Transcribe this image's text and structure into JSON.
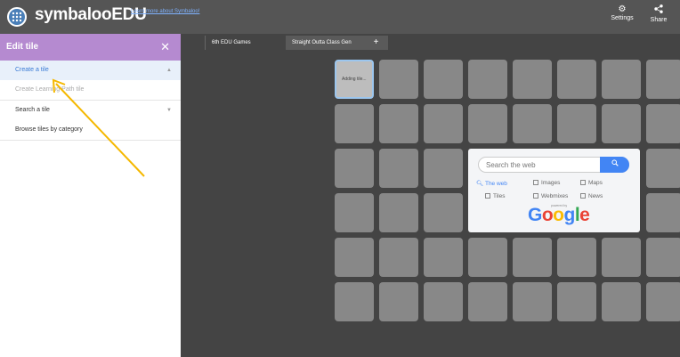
{
  "topbar": {
    "brand": "symbalooEDU",
    "learn_link": "Learn more about Symbaloo!",
    "settings_label": "Settings",
    "share_label": "Share"
  },
  "sidebar": {
    "title": "Edit tile",
    "close": "✕",
    "items": [
      {
        "label": "Create a tile"
      },
      {
        "label": "Create Learning Path tile"
      },
      {
        "label": "Search a tile"
      },
      {
        "label": "Browse tiles by category"
      }
    ]
  },
  "tabs": [
    {
      "label": "6th EDU Games"
    },
    {
      "label": "Straight Outta Class Gen"
    },
    {
      "label": "+"
    }
  ],
  "tile_adding_label": "Adding tile...",
  "google_widget": {
    "placeholder": "Search the web",
    "options": [
      {
        "label": "The web"
      },
      {
        "label": "Images"
      },
      {
        "label": "Maps"
      },
      {
        "label": "Tiles"
      },
      {
        "label": "Webmixes"
      },
      {
        "label": "News"
      }
    ],
    "powered_by": "powered by",
    "logo": "Google"
  }
}
